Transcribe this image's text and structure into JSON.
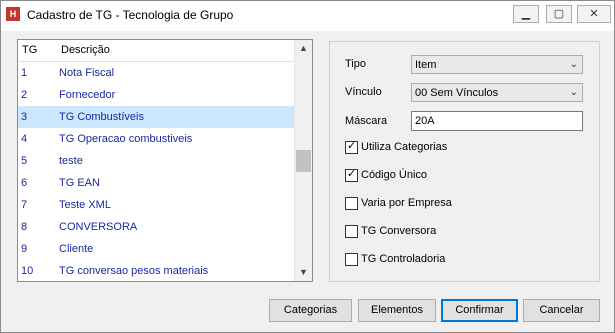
{
  "window": {
    "title": "Cadastro de TG - Tecnologia de Grupo",
    "app_icon_text": "H",
    "buttons": {
      "minimize": "▁",
      "maximize": "▢",
      "close": "✕"
    }
  },
  "list": {
    "columns": [
      "TG",
      "Descrição"
    ],
    "rows": [
      {
        "tg": "1",
        "descricao": "Nota Fiscal"
      },
      {
        "tg": "2",
        "descricao": "Fornecedor"
      },
      {
        "tg": "3",
        "descricao": "TG Combustíveis"
      },
      {
        "tg": "4",
        "descricao": "TG Operacao combustiveis"
      },
      {
        "tg": "5",
        "descricao": "teste"
      },
      {
        "tg": "6",
        "descricao": "TG EAN"
      },
      {
        "tg": "7",
        "descricao": "Teste XML"
      },
      {
        "tg": "8",
        "descricao": "CONVERSORA"
      },
      {
        "tg": "9",
        "descricao": "Cliente"
      },
      {
        "tg": "10",
        "descricao": "TG conversao pesos materiais"
      }
    ],
    "selected_index": 2,
    "scroll_up": "▲",
    "scroll_down": "▼"
  },
  "form": {
    "tipo": {
      "label": "Tipo",
      "value": "Item"
    },
    "vinculo": {
      "label": "Vínculo",
      "value": "00 Sem Vínculos"
    },
    "mascara": {
      "label": "Máscara",
      "value": "20A"
    },
    "dropdown_glyph": "⌄",
    "checkboxes": [
      {
        "label": "Utiliza Categorias",
        "checked": true
      },
      {
        "label": "Código Único",
        "checked": true
      },
      {
        "label": "Varia por Empresa",
        "checked": false
      },
      {
        "label": "TG Conversora",
        "checked": false
      },
      {
        "label": "TG Controladoria",
        "checked": false
      }
    ],
    "check_glyph": "✓"
  },
  "actions": {
    "categorias": "Categorias",
    "elementos": "Elementos",
    "confirmar": "Confirmar",
    "cancelar": "Cancelar"
  },
  "colors": {
    "selection": "#cce6ff",
    "list_text": "#1a2a9a",
    "accent": "#0078d7"
  }
}
